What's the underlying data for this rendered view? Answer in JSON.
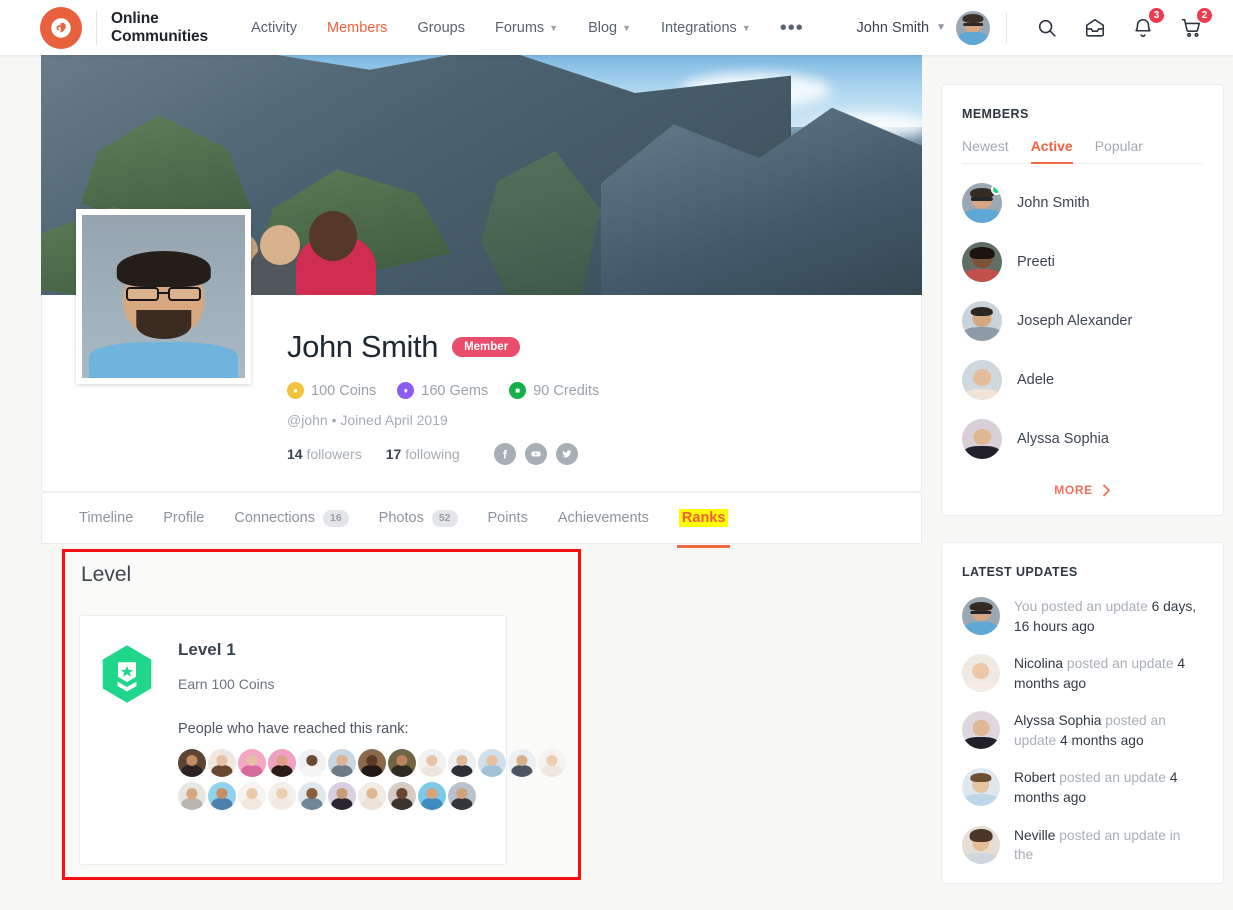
{
  "header": {
    "brand": {
      "line1": "Online",
      "line2": "Communities",
      "logo_icon": "bp-logo-icon"
    },
    "nav": [
      {
        "label": "Activity",
        "active": false,
        "caret": false
      },
      {
        "label": "Members",
        "active": true,
        "caret": false
      },
      {
        "label": "Groups",
        "active": false,
        "caret": false
      },
      {
        "label": "Forums",
        "active": false,
        "caret": true
      },
      {
        "label": "Blog",
        "active": false,
        "caret": true
      },
      {
        "label": "Integrations",
        "active": false,
        "caret": true
      }
    ],
    "more_dots": "•••",
    "user_name": "John Smith",
    "search_icon": "search-icon",
    "messages_icon": "inbox-icon",
    "notifications_icon": "bell-icon",
    "notifications_count": "3",
    "cart_icon": "cart-icon",
    "cart_count": "2",
    "accent": "#f0613c"
  },
  "profile": {
    "name": "John Smith",
    "member_badge": "Member",
    "points": [
      {
        "icon": "coin-icon",
        "value": "100 Coins",
        "color": "#f2c33d"
      },
      {
        "icon": "gem-icon",
        "value": "160 Gems",
        "color": "#8c5cf2"
      },
      {
        "icon": "credit-icon",
        "value": "90 Credits",
        "color": "#16b04a"
      }
    ],
    "handle": "@john",
    "separator": "•",
    "joined": "Joined April 2019",
    "followers_count": "14",
    "followers_label": "followers",
    "following_count": "17",
    "following_label": "following",
    "social": [
      "facebook-icon",
      "youtube-icon",
      "twitter-icon"
    ]
  },
  "tabs": [
    {
      "label": "Timeline",
      "count": null,
      "highlighted": false
    },
    {
      "label": "Profile",
      "count": null,
      "highlighted": false
    },
    {
      "label": "Connections",
      "count": "16",
      "highlighted": false
    },
    {
      "label": "Photos",
      "count": "52",
      "highlighted": false
    },
    {
      "label": "Points",
      "count": null,
      "highlighted": false
    },
    {
      "label": "Achievements",
      "count": null,
      "highlighted": false
    },
    {
      "label": "Ranks",
      "count": null,
      "highlighted": true
    }
  ],
  "level_section": {
    "title": "Level",
    "highlight_color": "#fb0d11",
    "badge_icon": "hex-rank-badge-icon",
    "badge_color": "#1fd68a",
    "rank_name": "Level 1",
    "requirement": "Earn 100 Coins",
    "reached_label": "People who have reached this rank:",
    "avatars_row1_count": 13,
    "avatars_row2_count": 10
  },
  "sidebar": {
    "members_widget": {
      "title": "MEMBERS",
      "tabs": [
        {
          "label": "Newest",
          "active": false
        },
        {
          "label": "Active",
          "active": true
        },
        {
          "label": "Popular",
          "active": false
        }
      ],
      "members": [
        {
          "name": "John Smith",
          "online": true
        },
        {
          "name": "Preeti",
          "online": false
        },
        {
          "name": "Joseph Alexander",
          "online": false
        },
        {
          "name": "Adele",
          "online": false
        },
        {
          "name": "Alyssa Sophia",
          "online": false
        }
      ],
      "more_label": "MORE",
      "more_icon": "chevron-right-icon"
    },
    "updates_widget": {
      "title": "LATEST UPDATES",
      "updates": [
        {
          "who": "You",
          "action": "posted an update",
          "time": "6 days, 16 hours ago"
        },
        {
          "who": "Nicolina",
          "action": "posted an update",
          "time": "4 months ago"
        },
        {
          "who": "Alyssa Sophia",
          "action": "posted an update",
          "time": "4 months ago"
        },
        {
          "who": "Robert",
          "action": "posted an update",
          "time": "4 months ago"
        },
        {
          "who": "Neville",
          "action": "posted an update in the",
          "time": ""
        }
      ]
    }
  }
}
